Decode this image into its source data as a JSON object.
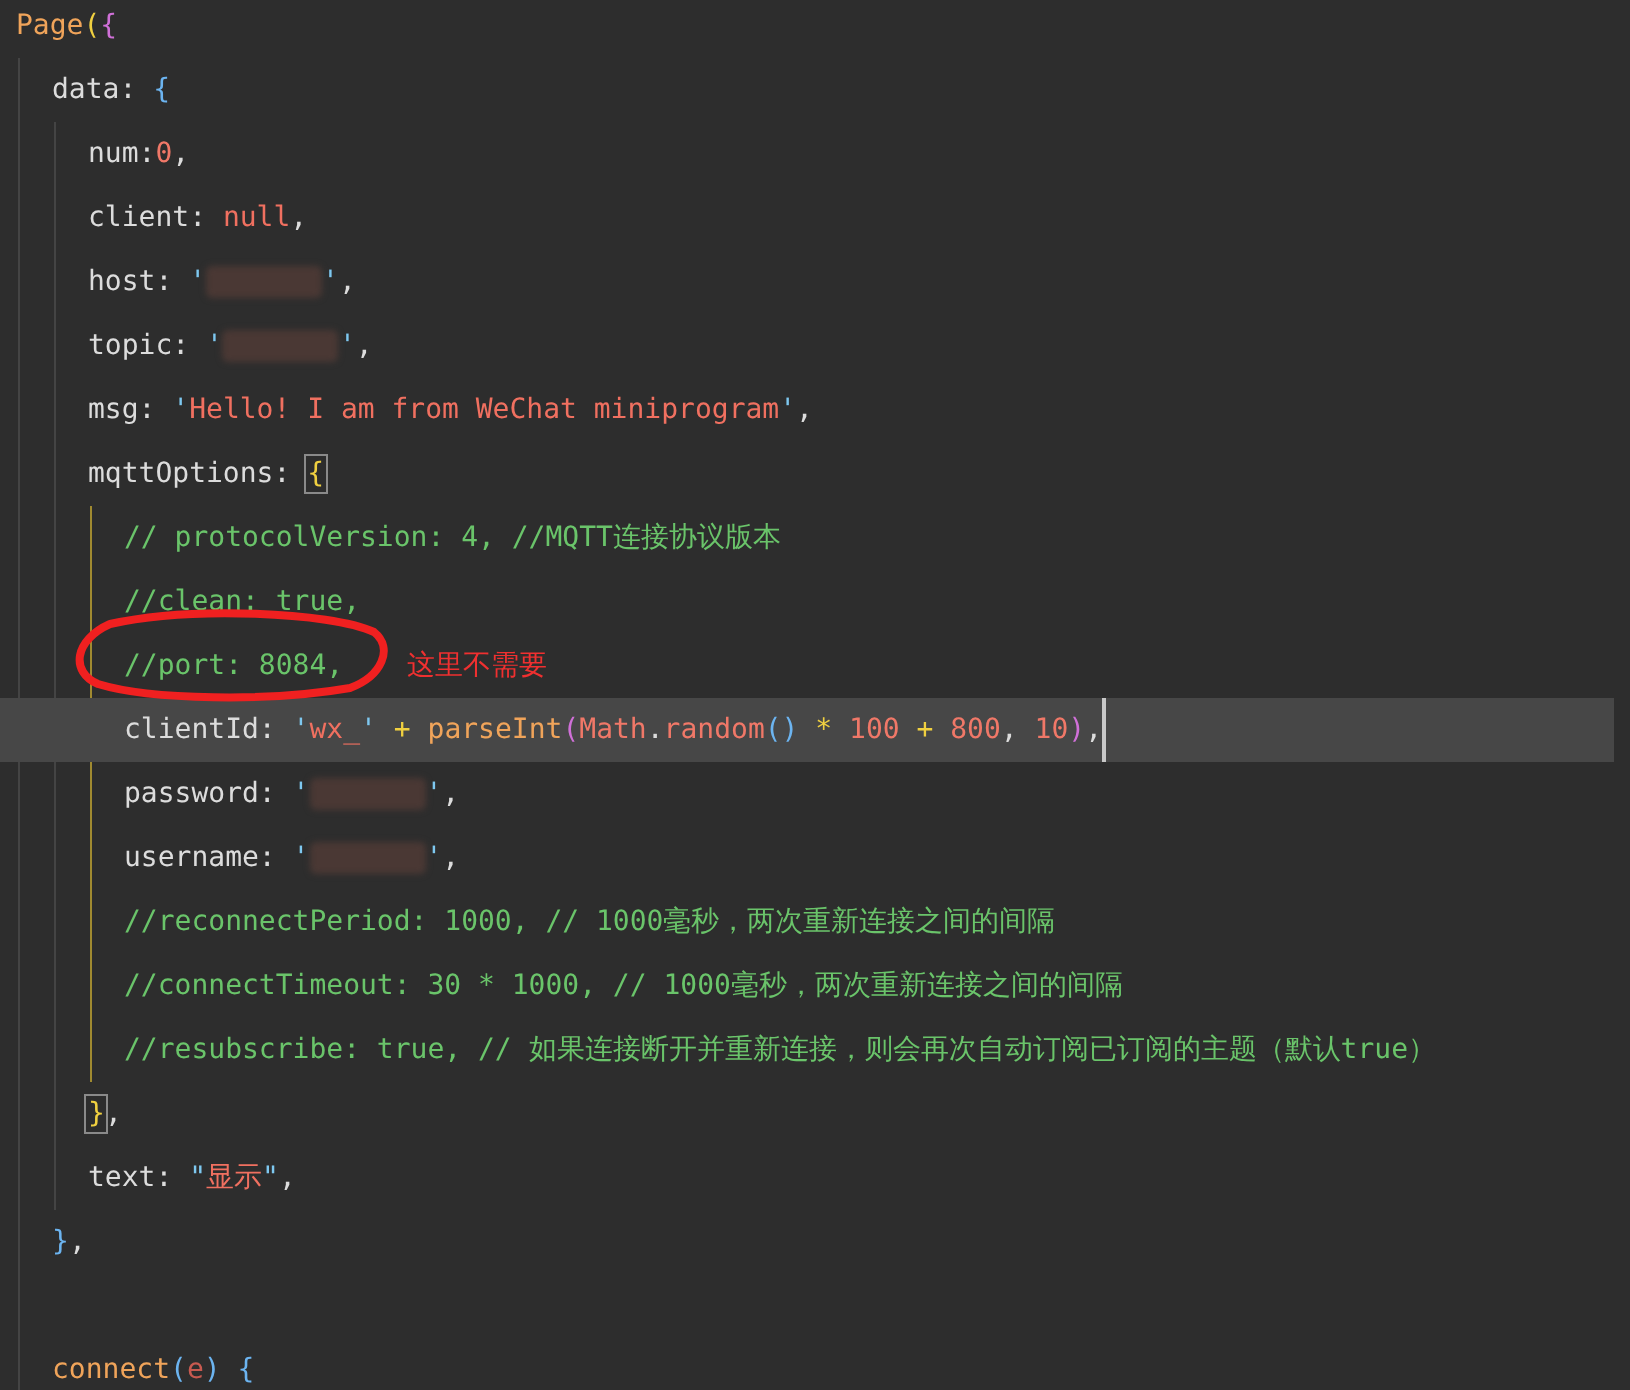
{
  "lines": [
    {
      "current": false,
      "tokens": [
        {
          "kind": "func",
          "text": "Page"
        },
        {
          "kind": "paren",
          "text": "("
        },
        {
          "kind": "brace",
          "text": "{"
        }
      ],
      "children": [
        {
          "current": false,
          "tokens": [
            {
              "kind": "plain",
              "text": "data: "
            },
            {
              "kind": "punct",
              "text": "{"
            }
          ],
          "children": [
            {
              "current": false,
              "tokens": [
                {
                  "kind": "plain",
                  "text": "num:"
                },
                {
                  "kind": "number",
                  "text": "0"
                },
                {
                  "kind": "plain",
                  "text": ","
                }
              ]
            },
            {
              "current": false,
              "tokens": [
                {
                  "kind": "plain",
                  "text": "client: "
                },
                {
                  "kind": "keyword",
                  "text": "null"
                },
                {
                  "kind": "plain",
                  "text": ","
                }
              ]
            },
            {
              "current": false,
              "tokens": [
                {
                  "kind": "plain",
                  "text": "host: "
                },
                {
                  "kind": "quote",
                  "text": "'"
                },
                {
                  "kind": "redacted"
                },
                {
                  "kind": "quote",
                  "text": "'"
                },
                {
                  "kind": "plain",
                  "text": ","
                }
              ]
            },
            {
              "current": false,
              "tokens": [
                {
                  "kind": "plain",
                  "text": "topic: "
                },
                {
                  "kind": "quote",
                  "text": "'"
                },
                {
                  "kind": "redacted"
                },
                {
                  "kind": "quote",
                  "text": "'"
                },
                {
                  "kind": "plain",
                  "text": ","
                }
              ]
            },
            {
              "current": false,
              "tokens": [
                {
                  "kind": "plain",
                  "text": "msg: "
                },
                {
                  "kind": "quote",
                  "text": "'"
                },
                {
                  "kind": "string",
                  "text": "Hello! I am from WeChat miniprogram"
                },
                {
                  "kind": "quote",
                  "text": "'"
                },
                {
                  "kind": "plain",
                  "text": ","
                }
              ]
            },
            {
              "current": false,
              "tokens": [
                {
                  "kind": "plain",
                  "text": "mqttOptions: "
                },
                {
                  "kind": "brace-match",
                  "text": "{"
                }
              ],
              "children": [
                {
                  "current": false,
                  "tokens": [
                    {
                      "kind": "comment",
                      "text": "// protocolVersion: 4, //MQTT连接协议版本"
                    }
                  ]
                },
                {
                  "current": false,
                  "tokens": [
                    {
                      "kind": "comment",
                      "text": "//clean: true,"
                    }
                  ]
                },
                {
                  "current": false,
                  "tokens": [
                    {
                      "kind": "comment",
                      "text": "//port: 8084,"
                    }
                  ],
                  "annotation": "这里不需要"
                },
                {
                  "current": true,
                  "tokens": [
                    {
                      "kind": "plain",
                      "text": "clientId: "
                    },
                    {
                      "kind": "quote",
                      "text": "'"
                    },
                    {
                      "kind": "string",
                      "text": "wx_"
                    },
                    {
                      "kind": "quote",
                      "text": "'"
                    },
                    {
                      "kind": "operator",
                      "text": " + "
                    },
                    {
                      "kind": "func",
                      "text": "parseInt"
                    },
                    {
                      "kind": "brace",
                      "text": "("
                    },
                    {
                      "kind": "property",
                      "text": "Math"
                    },
                    {
                      "kind": "plain",
                      "text": "."
                    },
                    {
                      "kind": "property",
                      "text": "random"
                    },
                    {
                      "kind": "punct",
                      "text": "()"
                    },
                    {
                      "kind": "operator",
                      "text": " * "
                    },
                    {
                      "kind": "number",
                      "text": "100"
                    },
                    {
                      "kind": "operator",
                      "text": " + "
                    },
                    {
                      "kind": "number",
                      "text": "800"
                    },
                    {
                      "kind": "plain",
                      "text": ", "
                    },
                    {
                      "kind": "number",
                      "text": "10"
                    },
                    {
                      "kind": "brace",
                      "text": ")"
                    },
                    {
                      "kind": "plain",
                      "text": ","
                    }
                  ]
                },
                {
                  "current": false,
                  "tokens": [
                    {
                      "kind": "plain",
                      "text": "password: "
                    },
                    {
                      "kind": "quote",
                      "text": "'"
                    },
                    {
                      "kind": "redacted"
                    },
                    {
                      "kind": "quote",
                      "text": "'"
                    },
                    {
                      "kind": "plain",
                      "text": ","
                    }
                  ]
                },
                {
                  "current": false,
                  "tokens": [
                    {
                      "kind": "plain",
                      "text": "username: "
                    },
                    {
                      "kind": "quote",
                      "text": "'"
                    },
                    {
                      "kind": "redacted"
                    },
                    {
                      "kind": "quote",
                      "text": "'"
                    },
                    {
                      "kind": "plain",
                      "text": ","
                    }
                  ]
                },
                {
                  "current": false,
                  "tokens": [
                    {
                      "kind": "comment",
                      "text": "//reconnectPeriod: 1000, // 1000毫秒，两次重新连接之间的间隔"
                    }
                  ]
                },
                {
                  "current": false,
                  "tokens": [
                    {
                      "kind": "comment",
                      "text": "//connectTimeout: 30 * 1000, // 1000毫秒，两次重新连接之间的间隔"
                    }
                  ]
                },
                {
                  "current": false,
                  "tokens": [
                    {
                      "kind": "comment",
                      "text": "//resubscribe: true, // 如果连接断开并重新连接，则会再次自动订阅已订阅的主题（默认true）"
                    }
                  ]
                }
              ]
            },
            {
              "current": false,
              "tokens": [
                {
                  "kind": "brace-match",
                  "text": "}"
                },
                {
                  "kind": "plain",
                  "text": ","
                }
              ]
            },
            {
              "current": false,
              "tokens": [
                {
                  "kind": "plain",
                  "text": "text: "
                },
                {
                  "kind": "quote",
                  "text": "\""
                },
                {
                  "kind": "string",
                  "text": "显示"
                },
                {
                  "kind": "quote",
                  "text": "\""
                },
                {
                  "kind": "plain",
                  "text": ","
                }
              ]
            }
          ]
        },
        {
          "current": false,
          "tokens": [
            {
              "kind": "punct",
              "text": "}"
            },
            {
              "kind": "plain",
              "text": ","
            }
          ]
        },
        {
          "current": false
        },
        {
          "current": false,
          "tokens": [
            {
              "kind": "func",
              "text": "connect"
            },
            {
              "kind": "punct",
              "text": "("
            },
            {
              "kind": "param",
              "text": "e"
            },
            {
              "kind": "punct",
              "text": ") "
            },
            {
              "kind": "punct",
              "text": "{"
            }
          ]
        }
      ]
    }
  ]
}
